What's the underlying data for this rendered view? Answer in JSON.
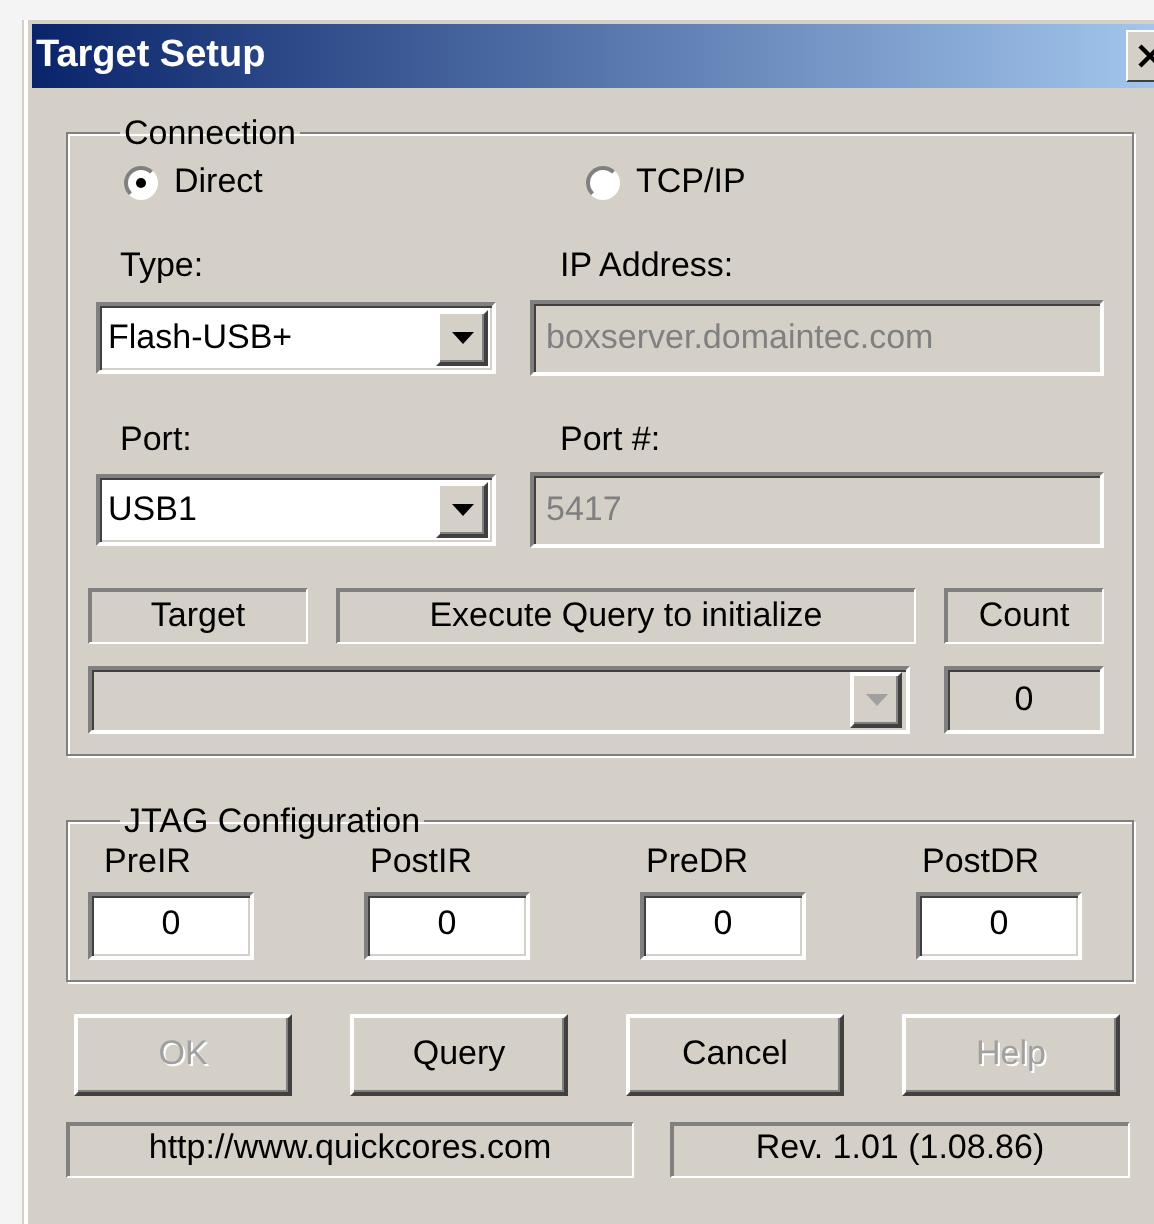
{
  "window": {
    "title": "Target Setup"
  },
  "connection": {
    "label": "Connection",
    "radios": [
      {
        "label": "Direct",
        "selected": true
      },
      {
        "label": "TCP/IP",
        "selected": false
      }
    ],
    "type": {
      "label": "Type:",
      "value": "Flash-USB+"
    },
    "ip_address": {
      "label": "IP Address:",
      "value": "boxserver.domaintec.com",
      "disabled": true
    },
    "port": {
      "label": "Port:",
      "value": "USB1"
    },
    "port_number": {
      "label": "Port #:",
      "value": "5417",
      "disabled": true
    },
    "target_headers": [
      "Target",
      "Execute Query to initialize",
      "Count"
    ],
    "target_select": {
      "disabled": true
    },
    "count": "0"
  },
  "jtag": {
    "label": "JTAG Configuration",
    "fields": [
      {
        "label": "PreIR",
        "value": "0"
      },
      {
        "label": "PostIR",
        "value": "0"
      },
      {
        "label": "PreDR",
        "value": "0"
      },
      {
        "label": "PostDR",
        "value": "0"
      }
    ]
  },
  "buttons": [
    {
      "label": "OK",
      "disabled": true
    },
    {
      "label": "Query",
      "disabled": false
    },
    {
      "label": "Cancel",
      "disabled": false
    },
    {
      "label": "Help",
      "disabled": true
    }
  ],
  "status_bar": [
    "http://www.quickcores.com",
    "Rev. 1.01 (1.08.86)"
  ]
}
